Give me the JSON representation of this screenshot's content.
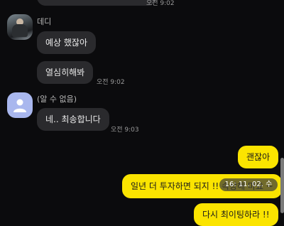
{
  "messages": {
    "m0_time": "오전 9:02",
    "sender1": {
      "name": "데디"
    },
    "m1": "예상 했잖아",
    "m2": "열심히해봐",
    "m2_time": "오전 9:02",
    "sender2": {
      "name": "(알 수 없음)"
    },
    "m3": "네.. 최송합니다",
    "m3_time": "오전 9:03",
    "m4": "괜잖아",
    "m5": "일년 더 투자하면 되지 !! 속상해 마요 ~",
    "m6": "다시 최이팅하라 !!"
  },
  "overlay": {
    "text": "16: 11. 02. 수"
  }
}
